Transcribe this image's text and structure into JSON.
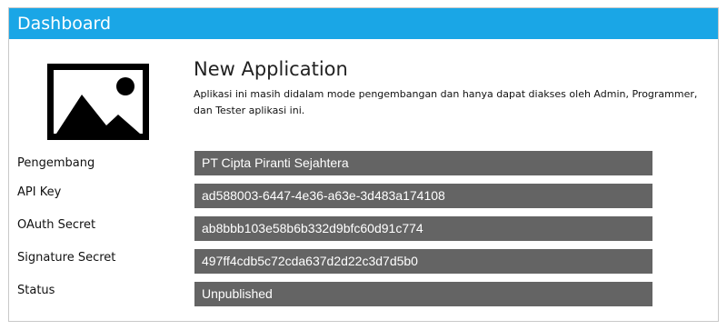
{
  "header": {
    "title": "Dashboard"
  },
  "app": {
    "image_icon": "image-placeholder-icon",
    "name": "New Application",
    "description": "Aplikasi ini masih didalam mode pengembangan dan hanya dapat diakses oleh Admin, Programmer, dan Tester aplikasi ini."
  },
  "fields": [
    {
      "label": "Pengembang",
      "value": "PT Cipta Piranti Sejahtera"
    },
    {
      "label": "API Key",
      "value": "ad588003-6447-4e36-a63e-3d483a174108"
    },
    {
      "label": "OAuth Secret",
      "value": "ab8bbb103e58b6b332d9bfc60d91c774"
    },
    {
      "label": "Signature Secret",
      "value": "497ff4cdb5c72cda637d2d22c3d7d5b0"
    },
    {
      "label": "Status",
      "value": "Unpublished"
    }
  ],
  "colors": {
    "header_bg": "#1aa6e6",
    "value_bg": "#646464"
  }
}
